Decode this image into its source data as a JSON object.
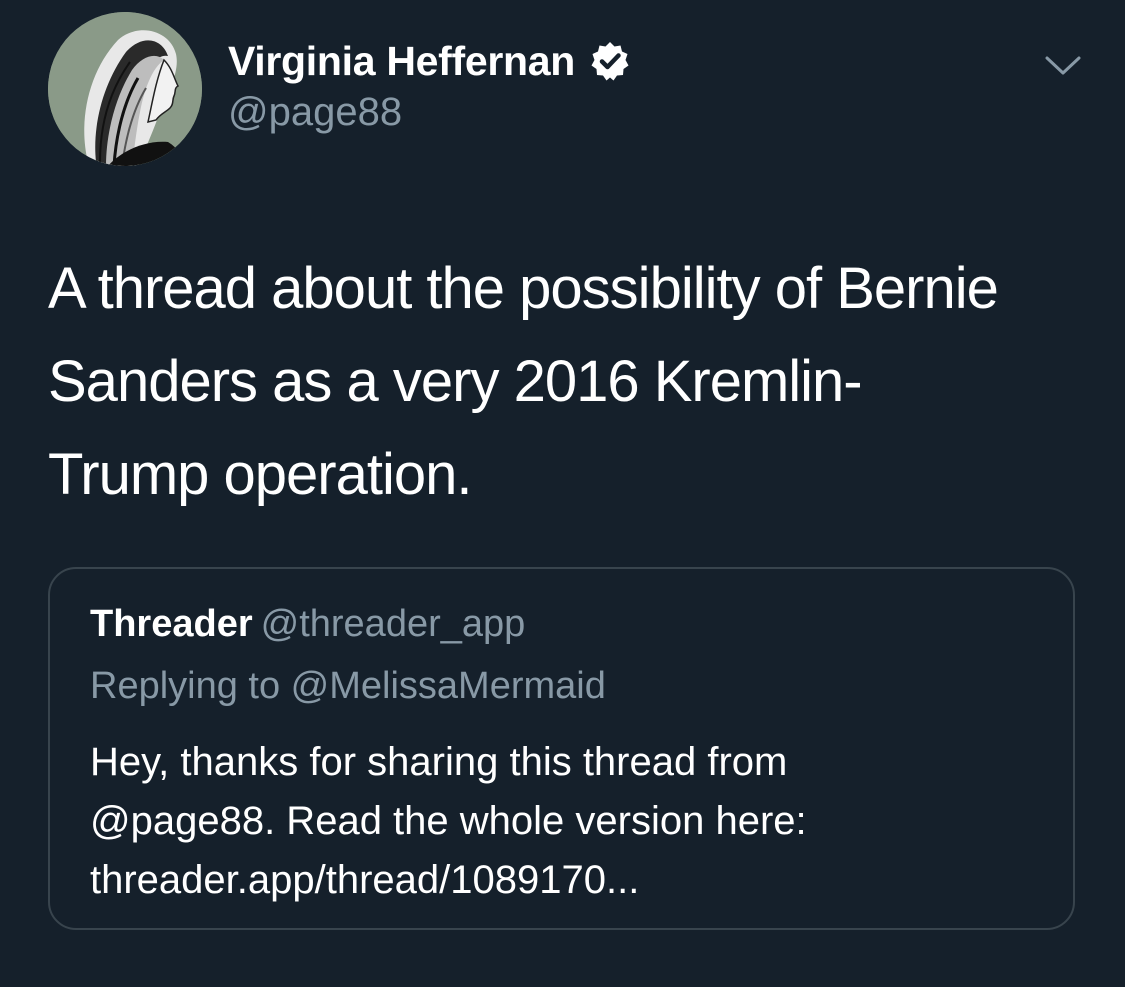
{
  "tweet": {
    "author": {
      "display_name": "Virginia Heffernan",
      "handle": "@page88",
      "verified": true,
      "avatar_icon": "profile-avatar-illustration"
    },
    "menu_icon": "chevron-down-icon",
    "text": "A thread about the possibility of Bernie\nSanders as a very 2016 Kremlin-\nTrump operation."
  },
  "quoted_tweet": {
    "author_name": "Threader",
    "author_handle": "@threader_app",
    "replying_to": "Replying to @MelissaMermaid",
    "text": "Hey, thanks for sharing this thread from\n@page88. Read the whole version here:\nthreader.app/thread/1089170..."
  },
  "colors": {
    "background": "#15202b",
    "primary_text": "#ffffff",
    "secondary_text": "#8899a6",
    "border": "#38444d"
  }
}
